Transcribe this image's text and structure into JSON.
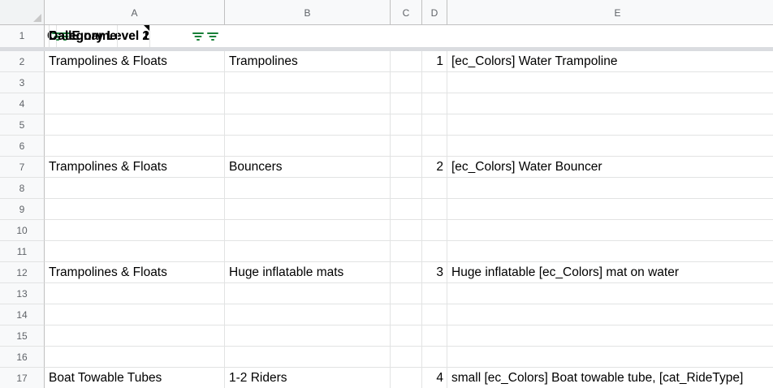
{
  "columns": [
    "A",
    "B",
    "C",
    "D",
    "E"
  ],
  "header": {
    "row_number": "1",
    "a": "Category Level 1",
    "b": "Category Level 2",
    "c": "C",
    "d": "",
    "e": "DallE name"
  },
  "rows": [
    {
      "n": "2",
      "a": "Trampolines & Floats",
      "b": "Trampolines",
      "d": "1",
      "e": "[ec_Colors] Water Trampoline"
    },
    {
      "n": "3",
      "a": "",
      "b": "",
      "d": "",
      "e": ""
    },
    {
      "n": "4",
      "a": "",
      "b": "",
      "d": "",
      "e": ""
    },
    {
      "n": "5",
      "a": "",
      "b": "",
      "d": "",
      "e": ""
    },
    {
      "n": "6",
      "a": "",
      "b": "",
      "d": "",
      "e": ""
    },
    {
      "n": "7",
      "a": "Trampolines & Floats",
      "b": "Bouncers",
      "d": "2",
      "e": "[ec_Colors] Water Bouncer"
    },
    {
      "n": "8",
      "a": "",
      "b": "",
      "d": "",
      "e": ""
    },
    {
      "n": "9",
      "a": "",
      "b": "",
      "d": "",
      "e": ""
    },
    {
      "n": "10",
      "a": "",
      "b": "",
      "d": "",
      "e": ""
    },
    {
      "n": "11",
      "a": "",
      "b": "",
      "d": "",
      "e": ""
    },
    {
      "n": "12",
      "a": "Trampolines & Floats",
      "b": "Huge inflatable mats",
      "d": "3",
      "e": "Huge inflatable [ec_Colors] mat on water"
    },
    {
      "n": "13",
      "a": "",
      "b": "",
      "d": "",
      "e": ""
    },
    {
      "n": "14",
      "a": "",
      "b": "",
      "d": "",
      "e": ""
    },
    {
      "n": "15",
      "a": "",
      "b": "",
      "d": "",
      "e": ""
    },
    {
      "n": "16",
      "a": "",
      "b": "",
      "d": "",
      "e": ""
    },
    {
      "n": "17",
      "a": "Boat Towable Tubes",
      "b": "1-2 Riders",
      "d": "4",
      "e": "small [ec_Colors] Boat towable tube, [cat_RideType]"
    }
  ],
  "colors": {
    "filter_icon": "#188038",
    "grid_line": "#e2e3e3",
    "header_bg": "#f8f9fa"
  },
  "icons": {
    "filter": "filter-icon",
    "note": "note-indicator"
  }
}
